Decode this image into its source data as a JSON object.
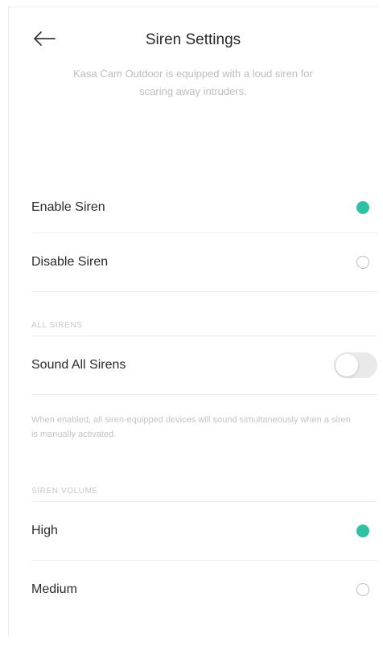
{
  "header": {
    "title": "Siren Settings",
    "subtitle": "Kasa Cam Outdoor is equipped with a loud siren for scaring away intruders."
  },
  "siren_mode": {
    "options": [
      {
        "label": "Enable Siren",
        "selected": true
      },
      {
        "label": "Disable Siren",
        "selected": false
      }
    ]
  },
  "all_sirens": {
    "section_label": "ALL SIRENS",
    "toggle_label": "Sound All Sirens",
    "toggle_on": false,
    "note": "When enabled, all siren-equipped devices will sound simultaneously when a siren is manually activated."
  },
  "volume": {
    "section_label": "SIREN VOLUME",
    "options": [
      {
        "label": "High",
        "selected": true
      },
      {
        "label": "Medium",
        "selected": false
      }
    ]
  },
  "colors": {
    "accent": "#2ec1a4",
    "divider": "#ececec",
    "muted_text": "#bdbdbd"
  },
  "icons": {
    "back": "back-arrow-icon"
  }
}
